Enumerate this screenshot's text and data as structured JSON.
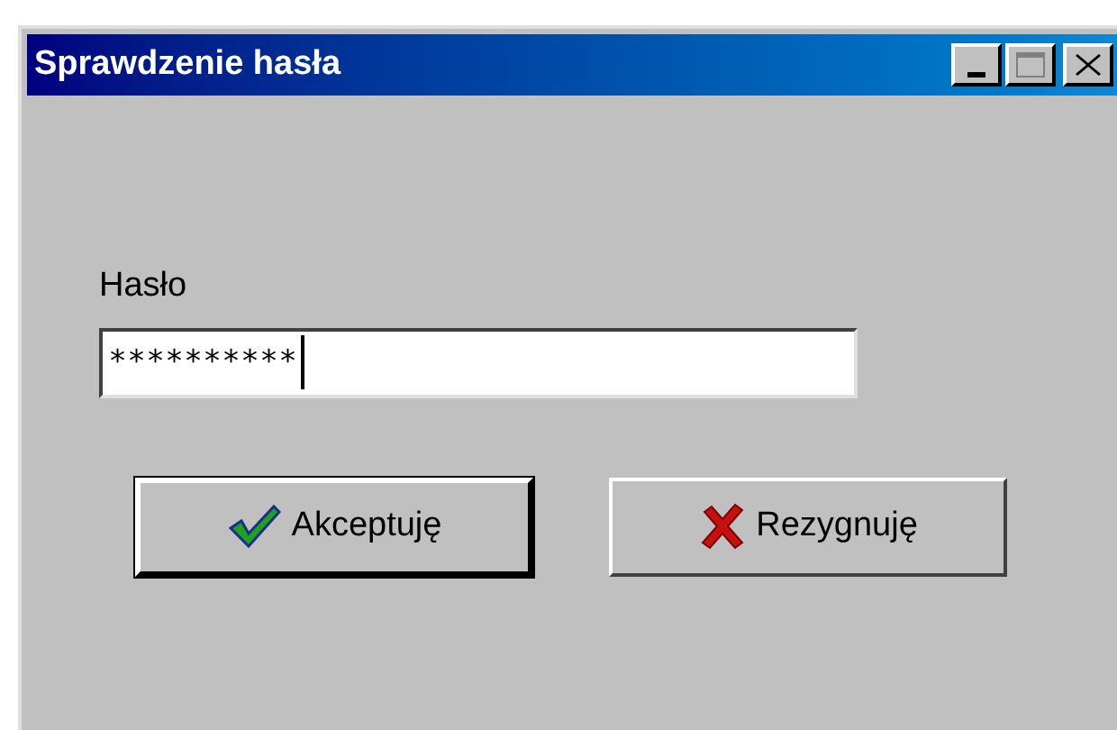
{
  "window": {
    "title": "Sprawdzenie hasła"
  },
  "field": {
    "label": "Hasło",
    "value": "**********",
    "focused": true
  },
  "buttons": [
    {
      "label": "Akceptuję",
      "kind": "accept",
      "default": true
    },
    {
      "label": "Rezygnuję",
      "kind": "cancel",
      "default": false
    }
  ]
}
